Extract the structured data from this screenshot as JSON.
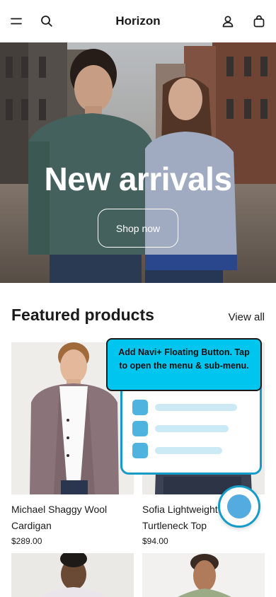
{
  "header": {
    "brand": "Horizon",
    "menu_icon": "menu-icon",
    "search_icon": "search-icon",
    "account_icon": "account-icon",
    "cart_icon": "bag-icon"
  },
  "hero": {
    "title": "New arrivals",
    "button_label": "Shop now"
  },
  "featured": {
    "title": "Featured products",
    "view_all": "View all",
    "products": [
      {
        "name": "Michael Shaggy Wool Cardigan",
        "price": "$289.00"
      },
      {
        "name": "Sofia Lightweight Turtleneck Top",
        "price": "$94.00"
      }
    ]
  },
  "navi": {
    "tooltip": "Add Navi+ Floating Button. Tap to open the menu & sub-menu.",
    "accent": "#00c6ef",
    "border": "#159bc8"
  }
}
